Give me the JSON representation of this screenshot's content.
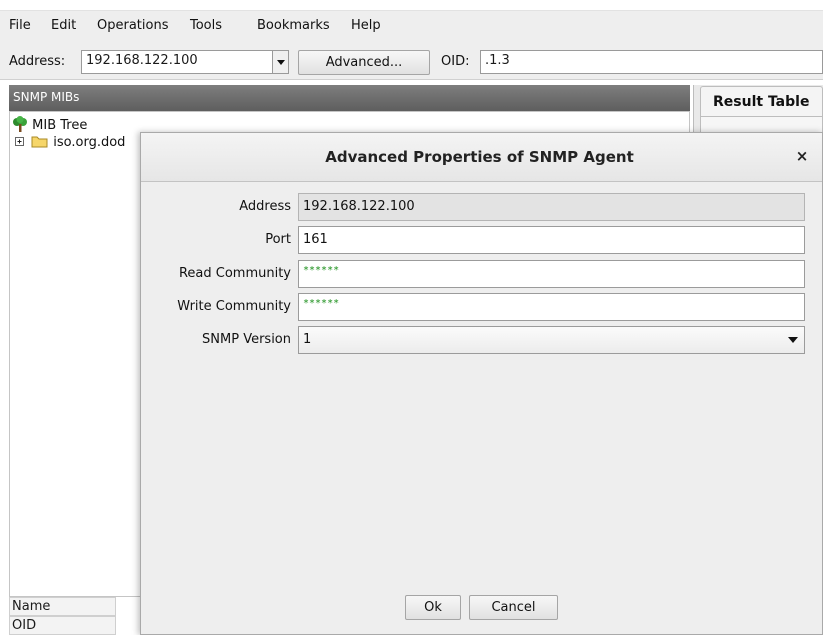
{
  "menu": [
    "File",
    "Edit",
    "Operations",
    "Tools",
    "Bookmarks",
    "Help"
  ],
  "toolbar": {
    "address_label": "Address:",
    "address_value": "192.168.122.100",
    "advanced_label": "Advanced...",
    "oid_label": "OID:",
    "oid_value": ".1.3"
  },
  "left_panel": {
    "header": "SNMP MIBs",
    "tree": [
      {
        "label": "MIB Tree",
        "icon": "tree-icon"
      },
      {
        "label": "iso.org.dod",
        "icon": "folder-icon"
      }
    ],
    "bottom_rows": [
      "Name",
      "OID"
    ]
  },
  "right_panel": {
    "tab": "Result Table"
  },
  "dialog": {
    "title": "Advanced Properties of SNMP Agent",
    "close": "×",
    "fields": {
      "address": {
        "label": "Address",
        "value": "192.168.122.100"
      },
      "port": {
        "label": "Port",
        "value": "161"
      },
      "read_community": {
        "label": "Read Community",
        "value": "******"
      },
      "write_community": {
        "label": "Write Community",
        "value": "******"
      },
      "snmp_version": {
        "label": "SNMP Version",
        "value": "1"
      }
    },
    "ok": "Ok",
    "cancel": "Cancel"
  }
}
